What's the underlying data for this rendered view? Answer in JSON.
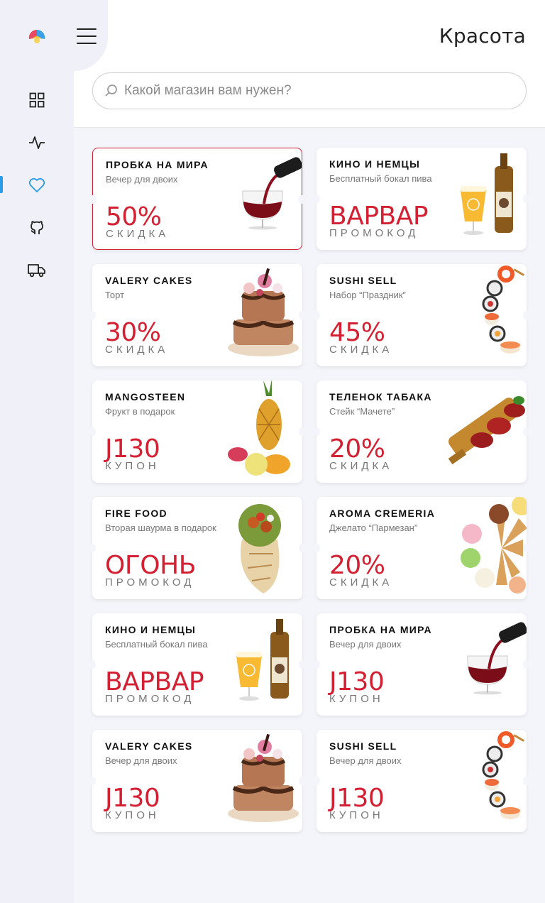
{
  "header": {
    "title": "Красота",
    "search_placeholder": "Какой магазин вам нужен?"
  },
  "sidebar": {
    "items": [
      {
        "icon": "grid-icon",
        "active": false
      },
      {
        "icon": "activity-icon",
        "active": false
      },
      {
        "icon": "heart-icon",
        "active": true
      },
      {
        "icon": "github-icon",
        "active": false
      },
      {
        "icon": "truck-icon",
        "active": false
      }
    ]
  },
  "colors": {
    "accent": "#d32032",
    "active_nav": "#2a9be6",
    "sidebar_bg": "#eff0f8",
    "page_bg": "#f4f5fa"
  },
  "cards": [
    {
      "shop": "ПРОБКА НА МИРА",
      "offer": "Вечер для двоих",
      "value": "50%",
      "kind": "СКИДКА",
      "image": "wine-glass",
      "selected": true
    },
    {
      "shop": "КИНО И НЕМЦЫ",
      "offer": "Бесплатный бокал пива",
      "value": "ВАРВАР",
      "kind": "ПРОМОКОД",
      "image": "beer",
      "selected": false
    },
    {
      "shop": "VALERY CAKES",
      "offer": "Торт",
      "value": "30%",
      "kind": "СКИДКА",
      "image": "cake",
      "selected": false
    },
    {
      "shop": "SUSHI SELL",
      "offer": "Набор “Праздник”",
      "value": "45%",
      "kind": "СКИДКА",
      "image": "sushi",
      "selected": false
    },
    {
      "shop": "MANGOSTEEN",
      "offer": "Фрукт в подарок",
      "value": "J130",
      "kind": "КУПОН",
      "image": "fruit",
      "selected": false
    },
    {
      "shop": "ТЕЛЕНОК ТАБАКА",
      "offer": "Стейк “Мачете”",
      "value": "20%",
      "kind": "СКИДКА",
      "image": "steak",
      "selected": false
    },
    {
      "shop": "FIRE FOOD",
      "offer": "Вторая шаурма в подарок",
      "value": "ОГОНЬ",
      "kind": "ПРОМОКОД",
      "image": "shawarma",
      "selected": false
    },
    {
      "shop": "AROMA CREMERIA",
      "offer": "Джелато “Пармезан”",
      "value": "20%",
      "kind": "СКИДКА",
      "image": "ice-cream",
      "selected": false
    },
    {
      "shop": "КИНО И НЕМЦЫ",
      "offer": "Бесплатный бокал пива",
      "value": "ВАРВАР",
      "kind": "ПРОМОКОД",
      "image": "beer",
      "selected": false
    },
    {
      "shop": "ПРОБКА НА МИРА",
      "offer": "Вечер для двоих",
      "value": "J130",
      "kind": "КУПОН",
      "image": "wine-glass",
      "selected": false
    },
    {
      "shop": "VALERY CAKES",
      "offer": "Вечер для двоих",
      "value": "J130",
      "kind": "КУПОН",
      "image": "cake",
      "selected": false
    },
    {
      "shop": "SUSHI SELL",
      "offer": "Вечер для двоих",
      "value": "J130",
      "kind": "КУПОН",
      "image": "sushi",
      "selected": false
    }
  ]
}
